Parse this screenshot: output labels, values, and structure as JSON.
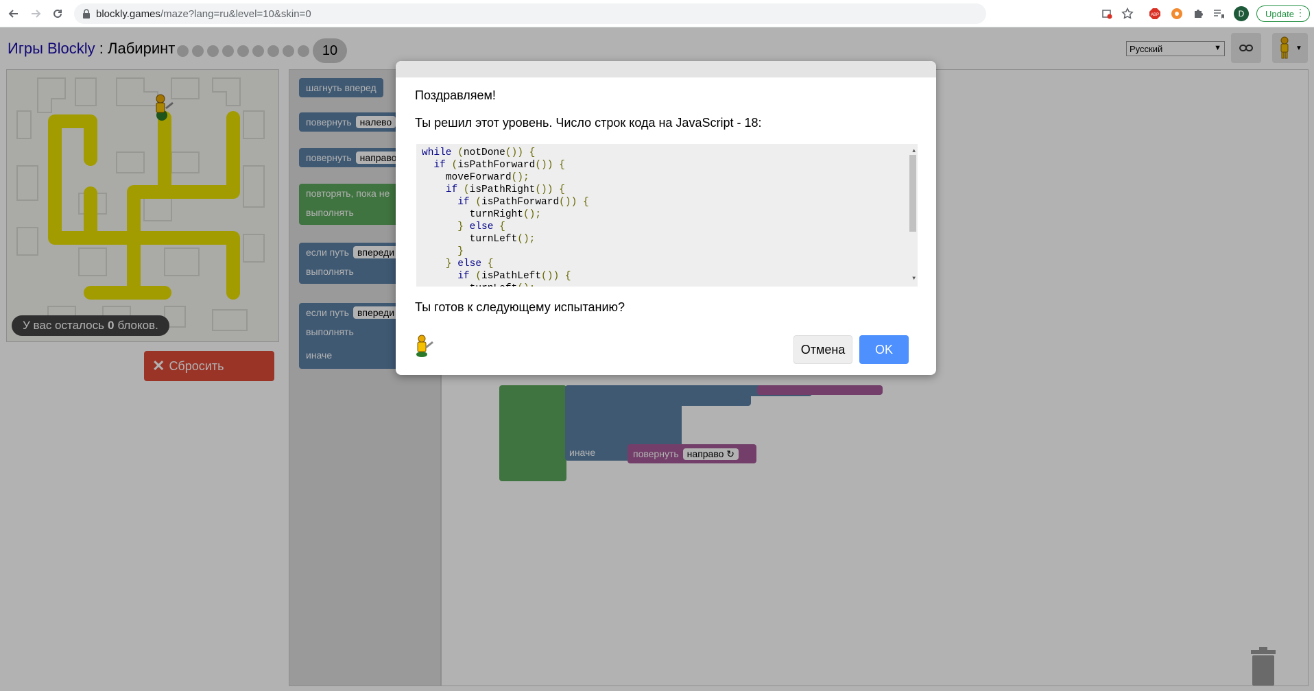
{
  "browser": {
    "url_host": "blockly.games",
    "url_path": "/maze?lang=ru&level=10&skin=0",
    "profile_initial": "D",
    "update_label": "Update"
  },
  "header": {
    "app_link": "Игры Blockly",
    "separator": " : ",
    "app_title": "Лабиринт",
    "current_level": "10",
    "language": "Русский"
  },
  "maze": {
    "capacity_prefix": "У вас осталось",
    "capacity_count": "0",
    "capacity_suffix": "блоков."
  },
  "controls": {
    "reset_label": "Сбросить"
  },
  "toolbox": {
    "move_forward": "шагнуть вперед",
    "turn": "повернуть",
    "left": "налево",
    "right": "направо",
    "repeat_until": "повторять, пока не",
    "do": "выполнять",
    "if_path": "если путь",
    "ahead": "впереди",
    "else": "иначе"
  },
  "workspace": {
    "else_label": "иначе",
    "turn_label": "повернуть",
    "right_label": "направо ↻"
  },
  "dialog": {
    "title": "Поздравляем!",
    "message": "Ты решил этот уровень. Число строк кода на JavaScript - 18:",
    "code_lines": [
      "while (notDone()) {",
      "  if (isPathForward()) {",
      "    moveForward();",
      "    if (isPathRight()) {",
      "      if (isPathForward()) {",
      "        turnRight();",
      "      } else {",
      "        turnLeft();",
      "      }",
      "    } else {",
      "      if (isPathLeft()) {",
      "        turnLeft();"
    ],
    "question": "Ты готов к следующему испытанию?",
    "cancel_label": "Отмена",
    "ok_label": "OK"
  }
}
